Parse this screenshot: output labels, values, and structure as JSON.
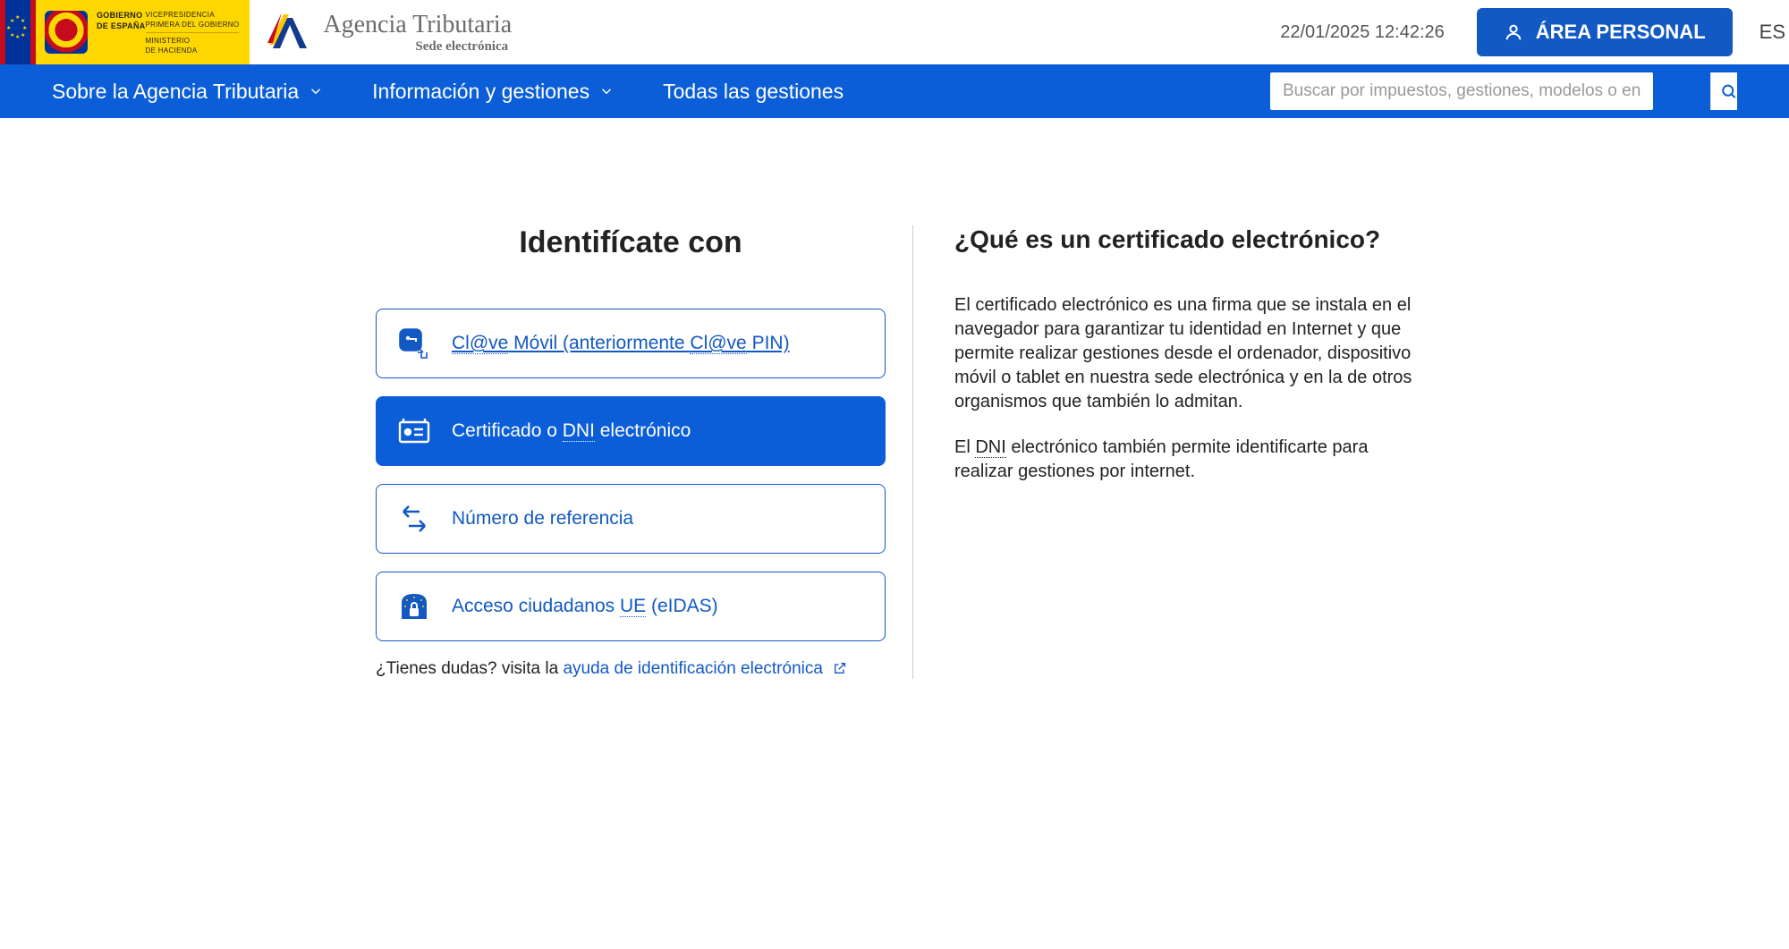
{
  "header": {
    "govt": {
      "line1a": "GOBIERNO",
      "line1b": "DE ESPAÑA",
      "line2a": "VICEPRESIDENCIA",
      "line2b": "PRIMERA DEL GOBIERNO",
      "line3a": "MINISTERIO",
      "line3b": "DE HACIENDA"
    },
    "agencia": {
      "title": "Agencia Tributaria",
      "subtitle": "Sede electrónica"
    },
    "timestamp": "22/01/2025 12:42:26",
    "area_personal": "ÁREA PERSONAL",
    "lang": "ES"
  },
  "nav": {
    "items": [
      {
        "label": "Sobre la Agencia Tributaria",
        "has_dropdown": true
      },
      {
        "label": "Información y gestiones",
        "has_dropdown": true
      },
      {
        "label": "Todas las gestiones",
        "has_dropdown": false
      }
    ],
    "search_placeholder": "Buscar por impuestos, gestiones, modelos o en Infor…"
  },
  "left": {
    "title": "Identifícate con",
    "options": [
      {
        "id": "clave",
        "pre": "Cl@ve",
        "mid": " Móvil (anteriormente ",
        "post": "Cl@ve",
        "tail": " PIN)"
      },
      {
        "id": "cert",
        "pre": "Certificado o ",
        "dotted": "DNI",
        "tail": " electrónico"
      },
      {
        "id": "ref",
        "label": "Número de referencia"
      },
      {
        "id": "eidas",
        "pre": "Acceso ciudadanos ",
        "dotted": "UE",
        "tail": " (eIDAS)"
      }
    ],
    "help_prefix": "¿Tienes dudas? visita la ",
    "help_link": "ayuda de identificación electrónica"
  },
  "right": {
    "title": "¿Qué es un certificado electrónico?",
    "p1": "El certificado electrónico es una firma que se instala en el navegador para garantizar tu identidad en Internet y que permite realizar gestiones desde el ordenador, dispositivo móvil o tablet en nuestra sede electrónica y en la de otros organismos que también lo admitan.",
    "p2a": "El ",
    "p2_dotted": "DNI",
    "p2b": " electrónico también permite identificarte para realizar gestiones por internet."
  }
}
